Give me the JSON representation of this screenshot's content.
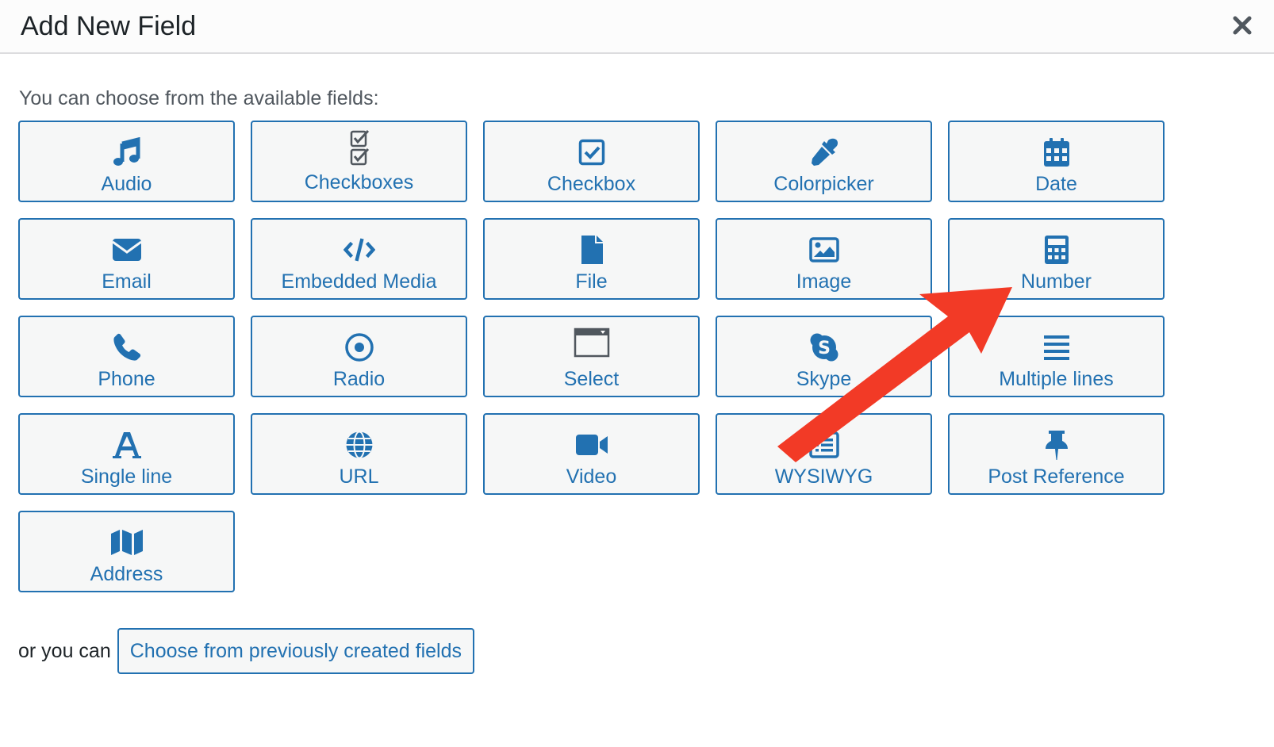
{
  "modal": {
    "title": "Add New Field",
    "intro": "You can choose from the available fields:",
    "footer_prefix": "or you can",
    "previous_fields_label": "Choose from previously created fields"
  },
  "fields": [
    {
      "label": "Audio",
      "icon": "music-icon"
    },
    {
      "label": "Checkboxes",
      "icon": "checkboxes-icon"
    },
    {
      "label": "Checkbox",
      "icon": "checkbox-icon"
    },
    {
      "label": "Colorpicker",
      "icon": "eyedropper-icon"
    },
    {
      "label": "Date",
      "icon": "calendar-icon"
    },
    {
      "label": "Email",
      "icon": "envelope-icon"
    },
    {
      "label": "Embedded Media",
      "icon": "code-icon"
    },
    {
      "label": "File",
      "icon": "file-icon"
    },
    {
      "label": "Image",
      "icon": "image-icon"
    },
    {
      "label": "Number",
      "icon": "calculator-icon"
    },
    {
      "label": "Phone",
      "icon": "phone-icon"
    },
    {
      "label": "Radio",
      "icon": "radio-icon"
    },
    {
      "label": "Select",
      "icon": "select-icon"
    },
    {
      "label": "Skype",
      "icon": "skype-icon"
    },
    {
      "label": "Multiple lines",
      "icon": "lines-icon"
    },
    {
      "label": "Single line",
      "icon": "letter-a-icon"
    },
    {
      "label": "URL",
      "icon": "globe-icon"
    },
    {
      "label": "Video",
      "icon": "video-camera-icon"
    },
    {
      "label": "WYSIWYG",
      "icon": "list-box-icon"
    },
    {
      "label": "Post Reference",
      "icon": "pushpin-icon"
    },
    {
      "label": "Address",
      "icon": "map-icon"
    }
  ],
  "colors": {
    "accent": "#2271b1",
    "button_bg": "#f6f7f7",
    "annotation_arrow": "#f23a26"
  }
}
